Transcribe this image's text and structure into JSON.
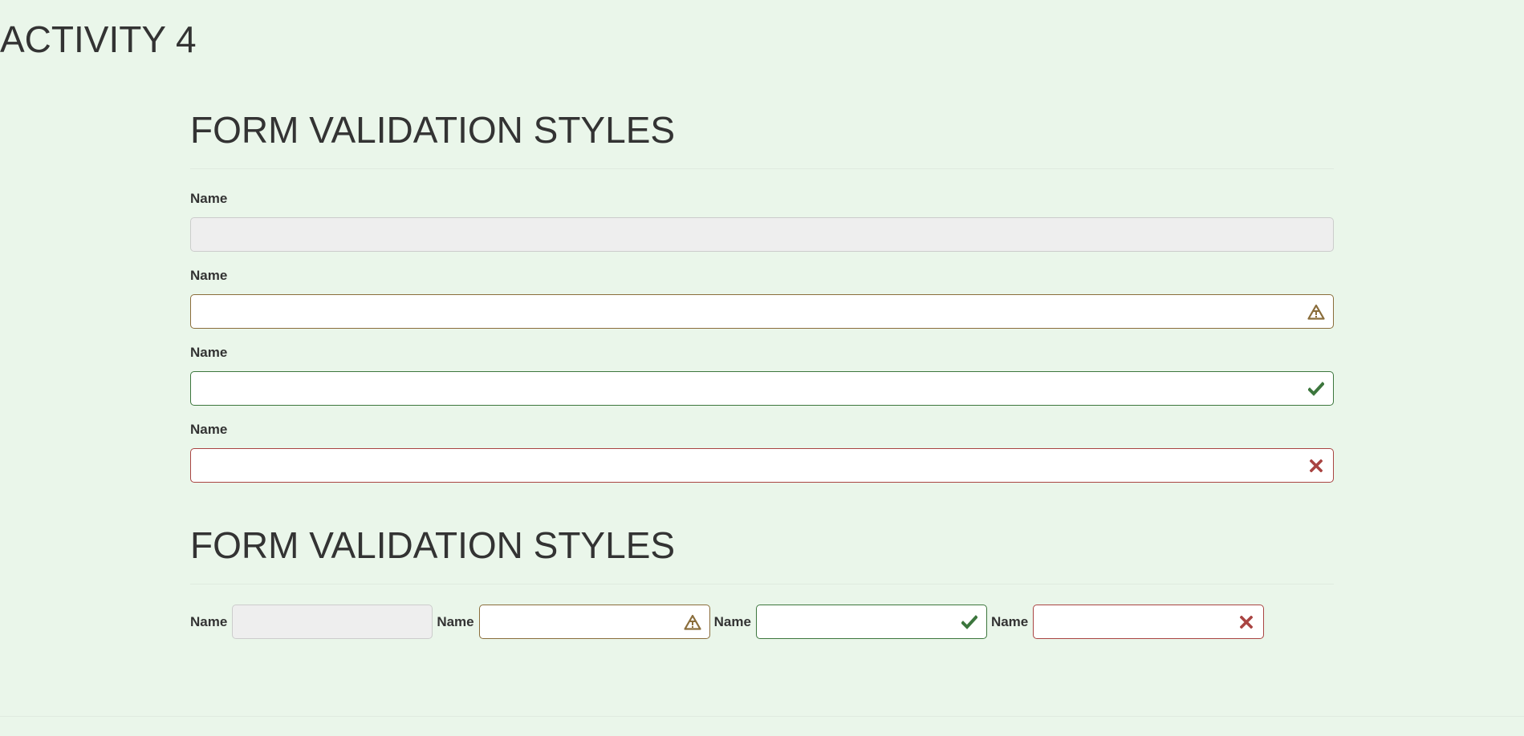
{
  "page": {
    "title": "ACTIVITY 4"
  },
  "section1": {
    "title": "FORM VALIDATION STYLES",
    "fields": [
      {
        "label": "Name",
        "state": "disabled",
        "value": ""
      },
      {
        "label": "Name",
        "state": "warning",
        "value": "",
        "icon": "warning-triangle-icon"
      },
      {
        "label": "Name",
        "state": "success",
        "value": "",
        "icon": "checkmark-icon"
      },
      {
        "label": "Name",
        "state": "error",
        "value": "",
        "icon": "cross-icon"
      }
    ]
  },
  "section2": {
    "title": "FORM VALIDATION STYLES",
    "fields": [
      {
        "label": "Name",
        "state": "disabled",
        "value": ""
      },
      {
        "label": "Name",
        "state": "warning",
        "value": "",
        "icon": "warning-triangle-icon"
      },
      {
        "label": "Name",
        "state": "success",
        "value": "",
        "icon": "checkmark-icon"
      },
      {
        "label": "Name",
        "state": "error",
        "value": "",
        "icon": "cross-icon"
      }
    ]
  },
  "colors": {
    "background": "#eaf6ea",
    "text": "#333333",
    "warning": "#8a6d3b",
    "success": "#3c763d",
    "error": "#a94442",
    "disabled_bg": "#eeeeee"
  }
}
